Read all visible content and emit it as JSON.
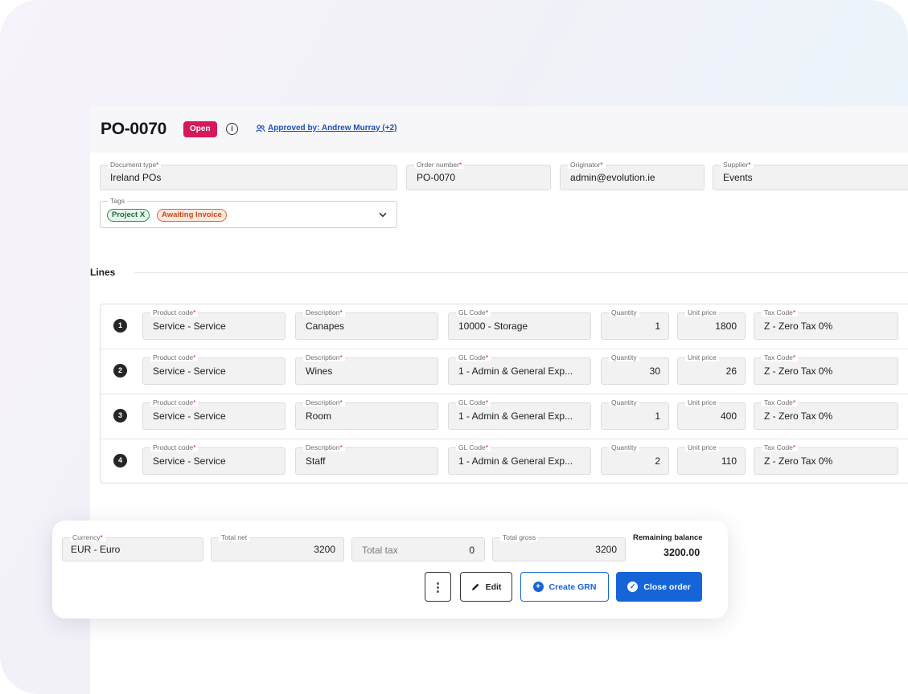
{
  "header": {
    "po_number": "PO-0070",
    "status": "Open",
    "approved_by": "Approved by: Andrew Murray (+2)"
  },
  "fields": {
    "document_type": {
      "label": "Document type",
      "value": "Ireland POs"
    },
    "order_number": {
      "label": "Order number",
      "value": "PO-0070"
    },
    "originator": {
      "label": "Originator",
      "value": "admin@evolution.ie"
    },
    "supplier": {
      "label": "Supplier",
      "value": "Events"
    },
    "tags": {
      "label": "Tags",
      "items": [
        "Project X",
        "Awaiting Invoice"
      ]
    }
  },
  "lines": {
    "title": "Lines",
    "columns": {
      "product_code": "Product code",
      "description": "Description",
      "gl_code": "GL Code",
      "quantity": "Quantity",
      "unit_price": "Unit price",
      "tax_code": "Tax Code"
    },
    "rows": [
      {
        "num": "1",
        "product_code": "Service - Service",
        "description": "Canapes",
        "gl_code": "10000 - Storage",
        "quantity": "1",
        "unit_price": "1800",
        "tax_code": "Z - Zero Tax 0%"
      },
      {
        "num": "2",
        "product_code": "Service - Service",
        "description": "Wines",
        "gl_code": "1 - Admin & General Exp...",
        "quantity": "30",
        "unit_price": "26",
        "tax_code": "Z - Zero Tax 0%"
      },
      {
        "num": "3",
        "product_code": "Service - Service",
        "description": "Room",
        "gl_code": "1 - Admin & General Exp...",
        "quantity": "1",
        "unit_price": "400",
        "tax_code": "Z - Zero Tax 0%"
      },
      {
        "num": "4",
        "product_code": "Service - Service",
        "description": "Staff",
        "gl_code": "1 - Admin & General Exp...",
        "quantity": "2",
        "unit_price": "110",
        "tax_code": "Z - Zero Tax 0%"
      }
    ]
  },
  "totals": {
    "currency_label": "Currency",
    "currency": "EUR - Euro",
    "total_net_label": "Total net",
    "total_net": "3200",
    "total_tax_label": "Total tax",
    "total_tax": "0",
    "total_gross_label": "Total gross",
    "total_gross": "3200",
    "remaining_balance_label": "Remaining balance",
    "remaining_balance": "3200.00"
  },
  "actions": {
    "more": "⋮",
    "edit": "Edit",
    "create_grn": "Create GRN",
    "close_order": "Close order"
  },
  "colors": {
    "accent": "#1565d8",
    "status_open": "#d5195a",
    "tag_green": "#2b8a52",
    "tag_orange": "#e0632e"
  }
}
